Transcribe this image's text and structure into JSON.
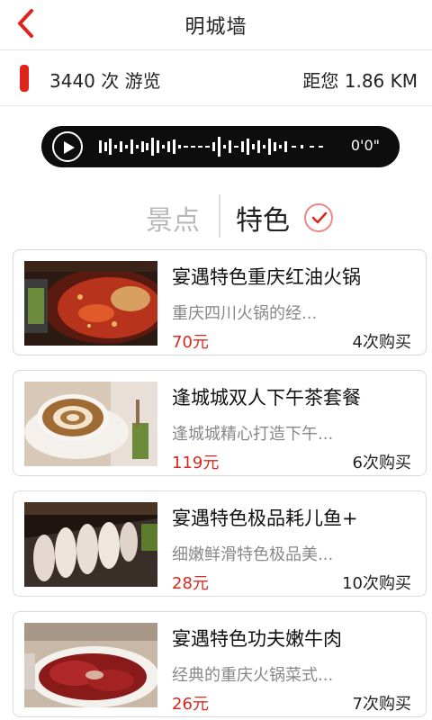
{
  "header": {
    "title": "明城墙",
    "back_icon": "chevron-left-icon",
    "accent_color": "#e0231b"
  },
  "info": {
    "views": "3440 次 游览",
    "distance": "距您 1.86 KM"
  },
  "audio": {
    "time": "0'0\"",
    "play_icon": "play-icon"
  },
  "tabs": {
    "spots": "景点",
    "featured": "特色",
    "active": "featured"
  },
  "items": [
    {
      "title": "宴遇特色重庆红油火锅",
      "desc": "重庆四川火锅的经...",
      "price": "70元",
      "sales": "4次购买"
    },
    {
      "title": "逢城城双人下午茶套餐",
      "desc": "逢城城精心打造下午...",
      "price": "119元",
      "sales": "6次购买"
    },
    {
      "title": "宴遇特色极品耗儿鱼+",
      "desc": "细嫩鲜滑特色极品美...",
      "price": "28元",
      "sales": "10次购买"
    },
    {
      "title": "宴遇特色功夫嫩牛肉",
      "desc": "经典的重庆火锅菜式...",
      "price": "26元",
      "sales": "7次购买"
    }
  ]
}
